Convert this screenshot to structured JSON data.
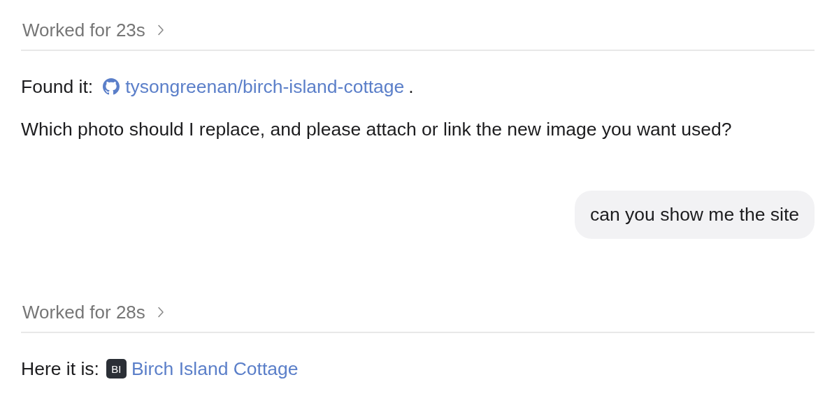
{
  "thread": [
    {
      "kind": "worked",
      "label": "Worked for 23s",
      "expanded": false
    },
    {
      "kind": "assistant",
      "lines": [
        {
          "text": "Found it:",
          "link": {
            "kind": "repo",
            "label": "tysongreenan/birch-island-cottage"
          },
          "suffix": "."
        },
        {
          "text": "Which photo should I replace, and please attach or link the new image you want used?"
        }
      ]
    },
    {
      "kind": "user",
      "text": "can you show me the site"
    },
    {
      "kind": "worked",
      "label": "Worked for 28s",
      "expanded": false
    },
    {
      "kind": "assistant",
      "lines": [
        {
          "text": "Here it is:",
          "link": {
            "kind": "site",
            "badge": "BI",
            "label": "Birch Island Cottage"
          }
        }
      ]
    }
  ]
}
